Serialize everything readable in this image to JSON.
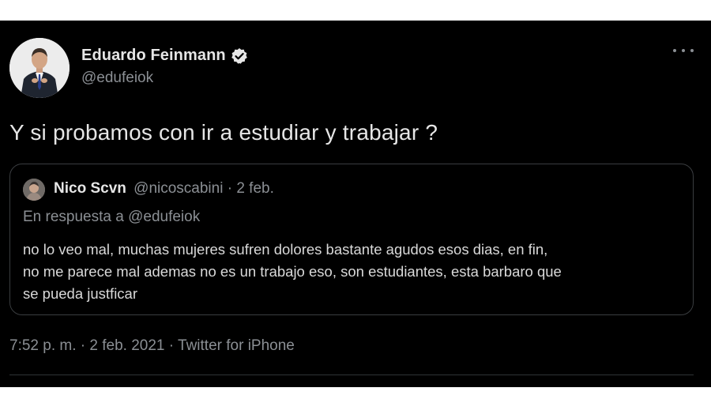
{
  "author": {
    "display_name": "Eduardo Feinmann",
    "handle": "@edufeiok",
    "verified_icon": "verified-badge-icon"
  },
  "tweet": {
    "text": "Y si probamos con ir a estudiar y trabajar ?",
    "time": "7:52 p. m.",
    "sep1": "·",
    "date": "2 feb. 2021",
    "sep2": "·",
    "source": "Twitter for iPhone"
  },
  "quoted": {
    "display_name": "Nico Scvn",
    "handle_date": "@nicoscabini · 2 feb.",
    "reply_to": "En respuesta a @edufeiok",
    "body_lines": [
      "no lo veo mal, muchas mujeres sufren dolores bastante agudos esos dias, en fin,",
      "no me parece mal ademas no es un trabajo eso, son estudiantes, esta barbaro que",
      "se pueda justficar"
    ]
  },
  "colors": {
    "background": "#000000",
    "primary_text": "#e6e6e6",
    "secondary_text": "#8b8f94",
    "border": "#3a3d40"
  },
  "icons": {
    "more": "more-horizontal-icon"
  }
}
